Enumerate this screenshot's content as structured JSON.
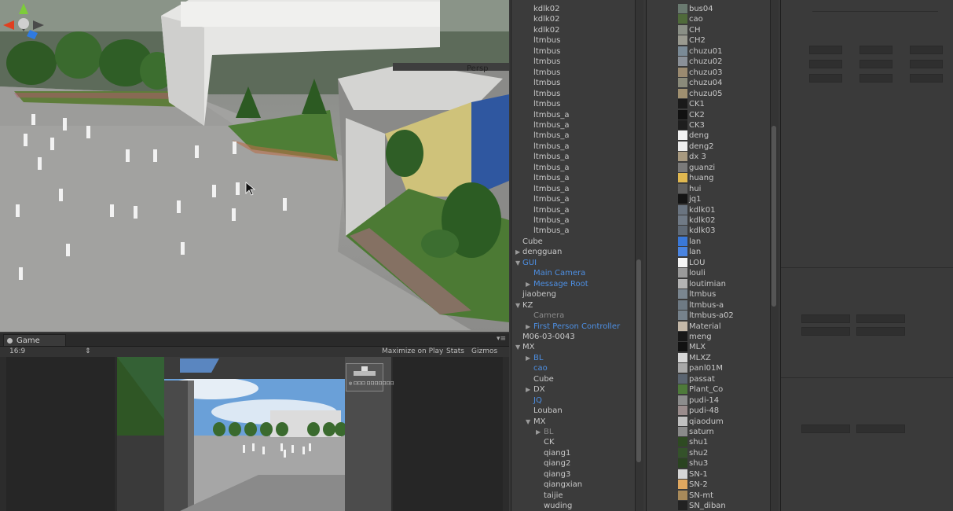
{
  "scene_view": {
    "camera_mode": "Persp"
  },
  "game_view": {
    "tab_label": "Game",
    "aspect": "16:9",
    "toolbar": {
      "maximize": "Maximize on Play",
      "stats": "Stats",
      "gizmos": "Gizmos"
    },
    "minimap_text": "◎ 口口口 口口口口口口口"
  },
  "hierarchy": [
    {
      "label": "kdlk02",
      "indent": 1,
      "color": "normal",
      "arrow": ""
    },
    {
      "label": "kdlk02",
      "indent": 1,
      "color": "normal",
      "arrow": ""
    },
    {
      "label": "kdlk02",
      "indent": 1,
      "color": "normal",
      "arrow": ""
    },
    {
      "label": "ltmbus",
      "indent": 1,
      "color": "normal",
      "arrow": ""
    },
    {
      "label": "ltmbus",
      "indent": 1,
      "color": "normal",
      "arrow": ""
    },
    {
      "label": "ltmbus",
      "indent": 1,
      "color": "normal",
      "arrow": ""
    },
    {
      "label": "ltmbus",
      "indent": 1,
      "color": "normal",
      "arrow": ""
    },
    {
      "label": "ltmbus",
      "indent": 1,
      "color": "normal",
      "arrow": ""
    },
    {
      "label": "ltmbus",
      "indent": 1,
      "color": "normal",
      "arrow": ""
    },
    {
      "label": "ltmbus",
      "indent": 1,
      "color": "normal",
      "arrow": ""
    },
    {
      "label": "ltmbus_a",
      "indent": 1,
      "color": "normal",
      "arrow": ""
    },
    {
      "label": "ltmbus_a",
      "indent": 1,
      "color": "normal",
      "arrow": ""
    },
    {
      "label": "ltmbus_a",
      "indent": 1,
      "color": "normal",
      "arrow": ""
    },
    {
      "label": "ltmbus_a",
      "indent": 1,
      "color": "normal",
      "arrow": ""
    },
    {
      "label": "ltmbus_a",
      "indent": 1,
      "color": "normal",
      "arrow": ""
    },
    {
      "label": "ltmbus_a",
      "indent": 1,
      "color": "normal",
      "arrow": ""
    },
    {
      "label": "ltmbus_a",
      "indent": 1,
      "color": "normal",
      "arrow": ""
    },
    {
      "label": "ltmbus_a",
      "indent": 1,
      "color": "normal",
      "arrow": ""
    },
    {
      "label": "ltmbus_a",
      "indent": 1,
      "color": "normal",
      "arrow": ""
    },
    {
      "label": "ltmbus_a",
      "indent": 1,
      "color": "normal",
      "arrow": ""
    },
    {
      "label": "ltmbus_a",
      "indent": 1,
      "color": "normal",
      "arrow": ""
    },
    {
      "label": "ltmbus_a",
      "indent": 1,
      "color": "normal",
      "arrow": ""
    },
    {
      "label": "Cube",
      "indent": 0,
      "color": "normal",
      "arrow": ""
    },
    {
      "label": "dengguan",
      "indent": 0,
      "color": "normal",
      "arrow": "right"
    },
    {
      "label": "GUI",
      "indent": 0,
      "color": "blue",
      "arrow": "down"
    },
    {
      "label": "Main Camera",
      "indent": 1,
      "color": "blue",
      "arrow": ""
    },
    {
      "label": "Message Root",
      "indent": 1,
      "color": "blue",
      "arrow": "right"
    },
    {
      "label": "jiaobeng",
      "indent": 0,
      "color": "normal",
      "arrow": ""
    },
    {
      "label": "KZ",
      "indent": 0,
      "color": "normal",
      "arrow": "down"
    },
    {
      "label": "Camera",
      "indent": 1,
      "color": "gray",
      "arrow": ""
    },
    {
      "label": "First Person Controller",
      "indent": 1,
      "color": "blue",
      "arrow": "right"
    },
    {
      "label": "M06-03-0043",
      "indent": 0,
      "color": "normal",
      "arrow": ""
    },
    {
      "label": "MX",
      "indent": 0,
      "color": "normal",
      "arrow": "down"
    },
    {
      "label": "BL",
      "indent": 1,
      "color": "blue",
      "arrow": "right"
    },
    {
      "label": "cao",
      "indent": 1,
      "color": "blue",
      "arrow": ""
    },
    {
      "label": "Cube",
      "indent": 1,
      "color": "normal",
      "arrow": ""
    },
    {
      "label": "DX",
      "indent": 1,
      "color": "normal",
      "arrow": "right"
    },
    {
      "label": "JQ",
      "indent": 1,
      "color": "blue",
      "arrow": ""
    },
    {
      "label": "Louban",
      "indent": 1,
      "color": "normal",
      "arrow": ""
    },
    {
      "label": "MX",
      "indent": 1,
      "color": "normal",
      "arrow": "down"
    },
    {
      "label": "BL",
      "indent": 2,
      "color": "gray",
      "arrow": "right"
    },
    {
      "label": "CK",
      "indent": 2,
      "color": "normal",
      "arrow": ""
    },
    {
      "label": "qiang1",
      "indent": 2,
      "color": "normal",
      "arrow": ""
    },
    {
      "label": "qiang2",
      "indent": 2,
      "color": "normal",
      "arrow": ""
    },
    {
      "label": "qiang3",
      "indent": 2,
      "color": "normal",
      "arrow": ""
    },
    {
      "label": "qiangxian",
      "indent": 2,
      "color": "normal",
      "arrow": ""
    },
    {
      "label": "taijie",
      "indent": 2,
      "color": "normal",
      "arrow": ""
    },
    {
      "label": "wuding",
      "indent": 2,
      "color": "normal",
      "arrow": ""
    }
  ],
  "project": [
    {
      "label": "bus04",
      "swatch": "#6a7a70"
    },
    {
      "label": "cao",
      "swatch": "#4f6a3a"
    },
    {
      "label": "CH",
      "swatch": "#8a8f86"
    },
    {
      "label": "CH2",
      "swatch": "#9a9a90"
    },
    {
      "label": "chuzu01",
      "swatch": "#7a8a96"
    },
    {
      "label": "chuzu02",
      "swatch": "#8a9098"
    },
    {
      "label": "chuzu03",
      "swatch": "#9a8a70"
    },
    {
      "label": "chuzu04",
      "swatch": "#8a8a7a"
    },
    {
      "label": "chuzu05",
      "swatch": "#a09070"
    },
    {
      "label": "CK1",
      "swatch": "#1a1a1a"
    },
    {
      "label": "CK2",
      "swatch": "#111111"
    },
    {
      "label": "CK3",
      "swatch": "#1e1e1e"
    },
    {
      "label": "deng",
      "swatch": "#f2f2f2"
    },
    {
      "label": "deng2",
      "swatch": "#eeeeee"
    },
    {
      "label": "dx 3",
      "swatch": "#a89a80"
    },
    {
      "label": "guanzi",
      "swatch": "#7a7a7a"
    },
    {
      "label": "huang",
      "swatch": "#e0b850"
    },
    {
      "label": "hui",
      "swatch": "#5e5e5e"
    },
    {
      "label": "jq1",
      "swatch": "#141414"
    },
    {
      "label": "kdlk01",
      "swatch": "#6a7480"
    },
    {
      "label": "kdlk02",
      "swatch": "#707a86"
    },
    {
      "label": "kdlk03",
      "swatch": "#606a76"
    },
    {
      "label": "lan",
      "swatch": "#3a78d8"
    },
    {
      "label": "lan",
      "swatch": "#4a84e0"
    },
    {
      "label": "LOU",
      "swatch": "#f4f4f4"
    },
    {
      "label": "louli",
      "swatch": "#9a9a9a"
    },
    {
      "label": "loutimian",
      "swatch": "#b4b4b4"
    },
    {
      "label": "ltmbus",
      "swatch": "#7a8690"
    },
    {
      "label": "ltmbus-a",
      "swatch": "#6e7a84"
    },
    {
      "label": "ltmbus-a02",
      "swatch": "#76828c"
    },
    {
      "label": "Material",
      "swatch": "#c4b8a8"
    },
    {
      "label": "meng",
      "swatch": "#181818"
    },
    {
      "label": "MLX",
      "swatch": "#121212"
    },
    {
      "label": "MLXZ",
      "swatch": "#d8d8d8"
    },
    {
      "label": "panl01M",
      "swatch": "#a8a8a8"
    },
    {
      "label": "passat",
      "swatch": "#5a6470"
    },
    {
      "label": "Plant_Co",
      "swatch": "#4e7a3a"
    },
    {
      "label": "pudi-14",
      "swatch": "#8c8c8c"
    },
    {
      "label": "pudi-48",
      "swatch": "#9a8c8c"
    },
    {
      "label": "qiaodum",
      "swatch": "#c0c0c0"
    },
    {
      "label": "saturn",
      "swatch": "#8a8a8a"
    },
    {
      "label": "shu1",
      "swatch": "#2e4a22"
    },
    {
      "label": "shu2",
      "swatch": "#34522a"
    },
    {
      "label": "shu3",
      "swatch": "#2a4420"
    },
    {
      "label": "SN-1",
      "swatch": "#d6d6d6"
    },
    {
      "label": "SN-2",
      "swatch": "#e0a860"
    },
    {
      "label": "SN-mt",
      "swatch": "#a88a5a"
    },
    {
      "label": "SN_diban",
      "swatch": "#222222"
    }
  ]
}
